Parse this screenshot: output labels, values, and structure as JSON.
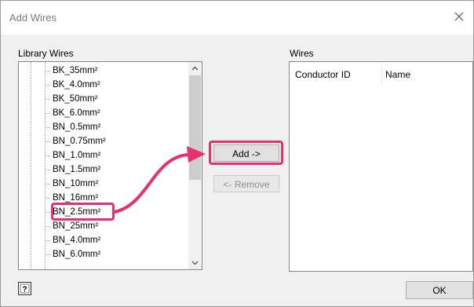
{
  "dialog": {
    "title": "Add Wires"
  },
  "library": {
    "label": "Library Wires",
    "items": [
      {
        "label": "BK_35mm²"
      },
      {
        "label": "BK_4.0mm²"
      },
      {
        "label": "BK_50mm²"
      },
      {
        "label": "BK_6.0mm²"
      },
      {
        "label": "BN_0.5mm²"
      },
      {
        "label": "BN_0.75mm²"
      },
      {
        "label": "BN_1.0mm²"
      },
      {
        "label": "BN_1.5mm²"
      },
      {
        "label": "BN_10mm²"
      },
      {
        "label": "BN_16mm²"
      },
      {
        "label": "BN_2.5mm²"
      },
      {
        "label": "BN_25mm²"
      },
      {
        "label": "BN_4.0mm²"
      },
      {
        "label": "BN_6.0mm²"
      }
    ],
    "highlighted_item": "BN_2.5mm²"
  },
  "buttons": {
    "add": "Add ->",
    "remove": "<- Remove",
    "ok": "OK"
  },
  "wires": {
    "label": "Wires",
    "columns": [
      "Conductor ID",
      "Name"
    ]
  },
  "icons": {
    "close": "close-icon",
    "help": "help-icon",
    "scroll_up": "chevron-up-icon",
    "scroll_down": "chevron-down-icon"
  },
  "colors": {
    "annotation": "#e8306f"
  }
}
